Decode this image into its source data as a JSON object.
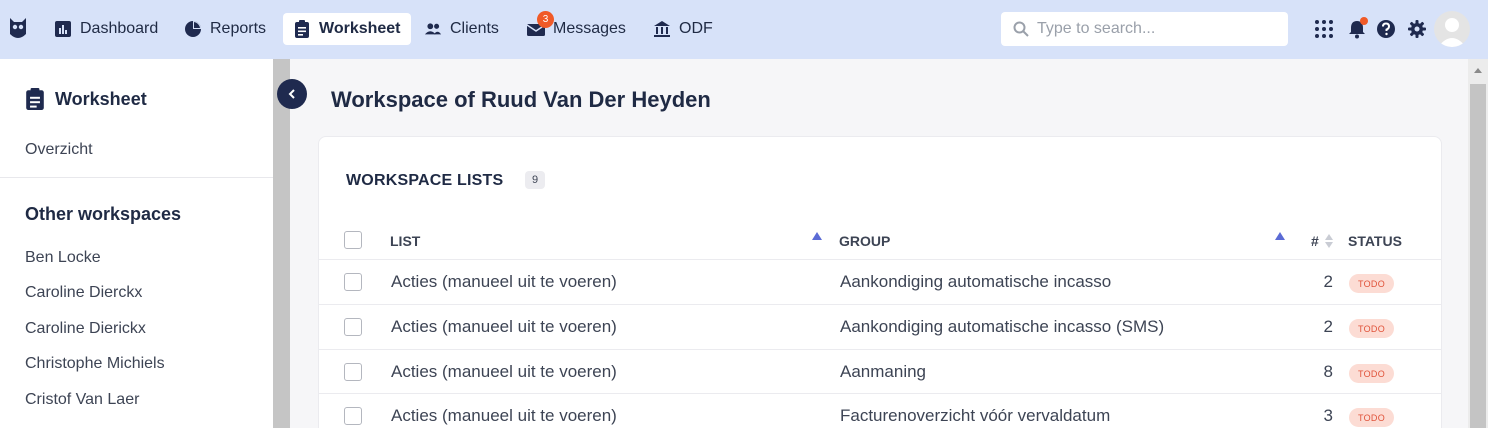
{
  "nav": {
    "items": [
      {
        "label": "Dashboard",
        "icon": "bar-chart-icon"
      },
      {
        "label": "Reports",
        "icon": "pie-chart-icon"
      },
      {
        "label": "Worksheet",
        "icon": "clipboard-icon",
        "active": true
      },
      {
        "label": "Clients",
        "icon": "users-icon"
      },
      {
        "label": "Messages",
        "icon": "envelope-icon",
        "badge": "3"
      },
      {
        "label": "ODF",
        "icon": "bank-icon"
      }
    ],
    "search_placeholder": "Type to search..."
  },
  "sidebar": {
    "title": "Worksheet",
    "overview": "Overzicht",
    "other_heading": "Other workspaces",
    "workspaces": [
      "Ben Locke",
      "Caroline Dierckx",
      "Caroline Dierickx",
      "Christophe Michiels",
      "Cristof Van Laer"
    ]
  },
  "main": {
    "title": "Workspace of Ruud Van Der Heyden",
    "card_title": "WORKSPACE LISTS",
    "card_count": "9",
    "columns": {
      "list": "LIST",
      "group": "GROUP",
      "num": "#",
      "status": "STATUS"
    },
    "rows": [
      {
        "list": "Acties (manueel uit te voeren)",
        "group": "Aankondiging automatische incasso",
        "num": "2",
        "status": "TODO"
      },
      {
        "list": "Acties (manueel uit te voeren)",
        "group": "Aankondiging automatische incasso (SMS)",
        "num": "2",
        "status": "TODO"
      },
      {
        "list": "Acties (manueel uit te voeren)",
        "group": "Aanmaning",
        "num": "8",
        "status": "TODO"
      },
      {
        "list": "Acties (manueel uit te voeren)",
        "group": "Facturenoverzicht vóór vervaldatum",
        "num": "3",
        "status": "TODO"
      }
    ]
  },
  "colors": {
    "topbar": "#d7e2f9",
    "accent": "#1f2a4f",
    "status_bg": "#fcdcd4",
    "status_text": "#e0533a",
    "badge": "#f05a28"
  }
}
